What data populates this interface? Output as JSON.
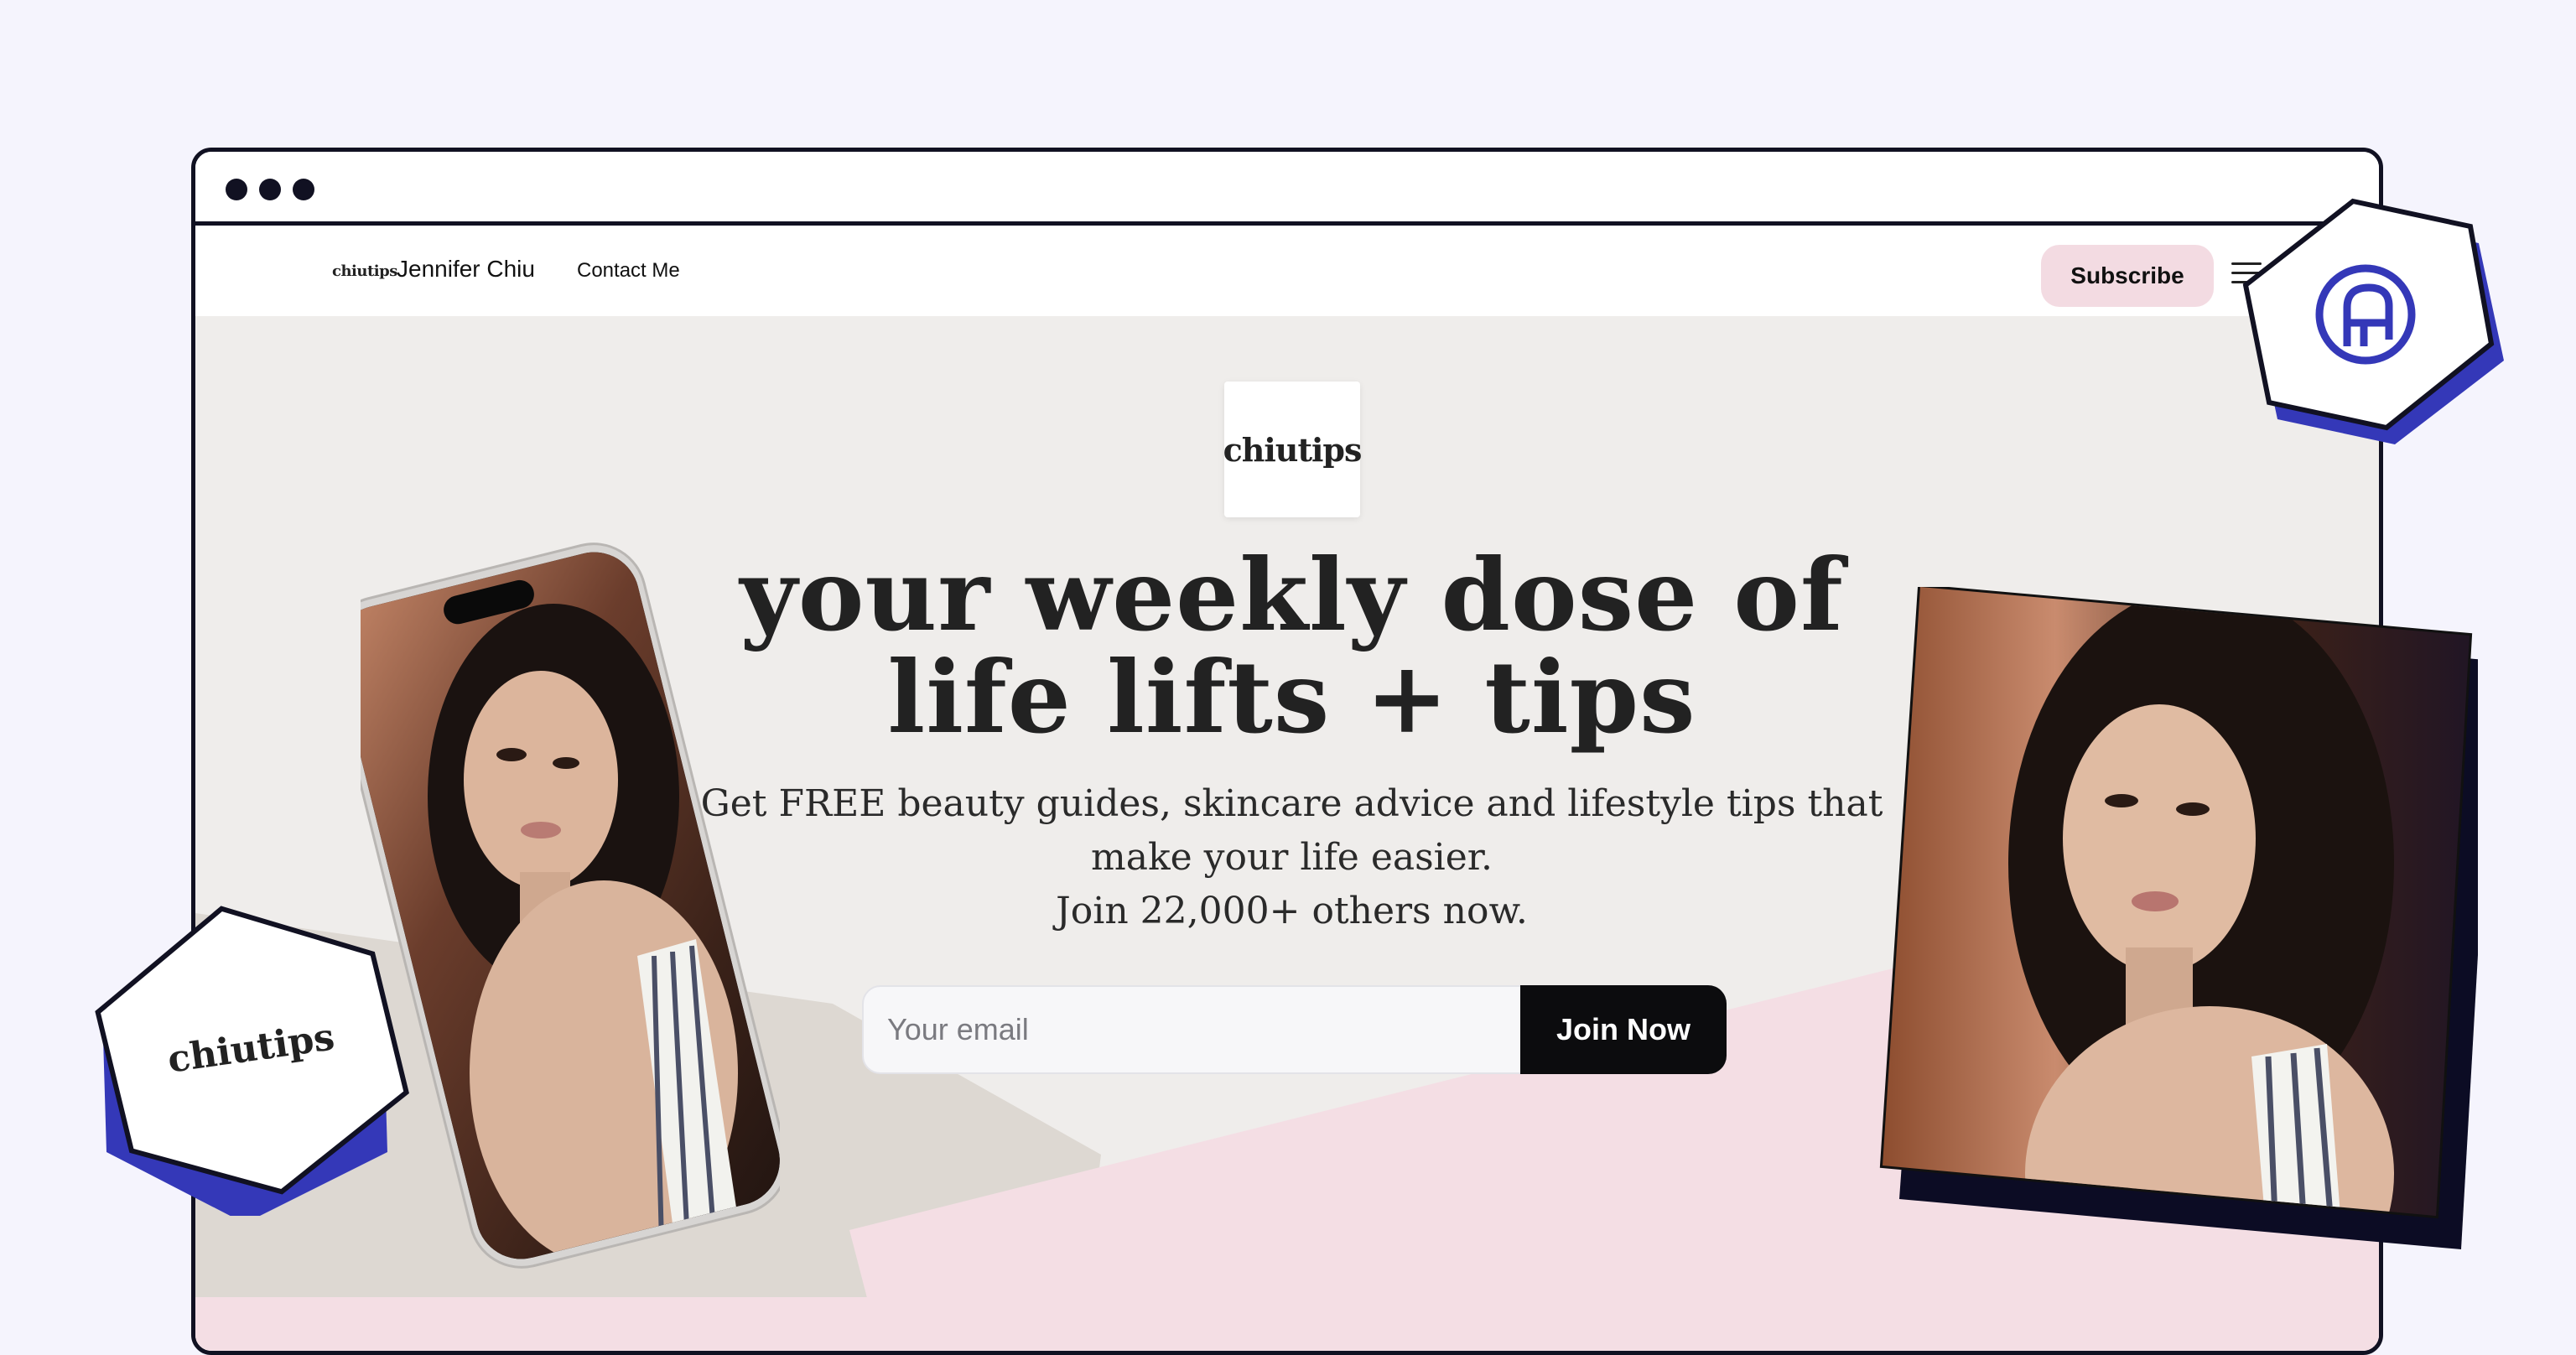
{
  "window": {
    "dots": 3
  },
  "nav": {
    "logo_small": "chiutips",
    "name": "Jennifer Chiu",
    "contact": "Contact Me",
    "subscribe": "Subscribe"
  },
  "hero": {
    "logo": "chiutips",
    "headline_line1": "your weekly dose of",
    "headline_line2": "life lifts + tips",
    "sub_line1": "Get FREE beauty guides, skincare advice and lifestyle tips that",
    "sub_line2": "make your life easier.",
    "sub_line3": "Join 22,000+ others now.",
    "email_placeholder": "Your email",
    "join_button": "Join Now"
  },
  "badges": {
    "left_logo": "chiutips",
    "right_icon": "brand-logo-icon"
  },
  "colors": {
    "page_bg": "#f5f4fd",
    "hero_bg": "#efedeb",
    "beige_shape": "#ddd8d2",
    "pink_shape": "#f4dee4",
    "subscribe_bg": "#f3dbe2",
    "accent_blue": "#3438b8",
    "dark": "#111122"
  }
}
